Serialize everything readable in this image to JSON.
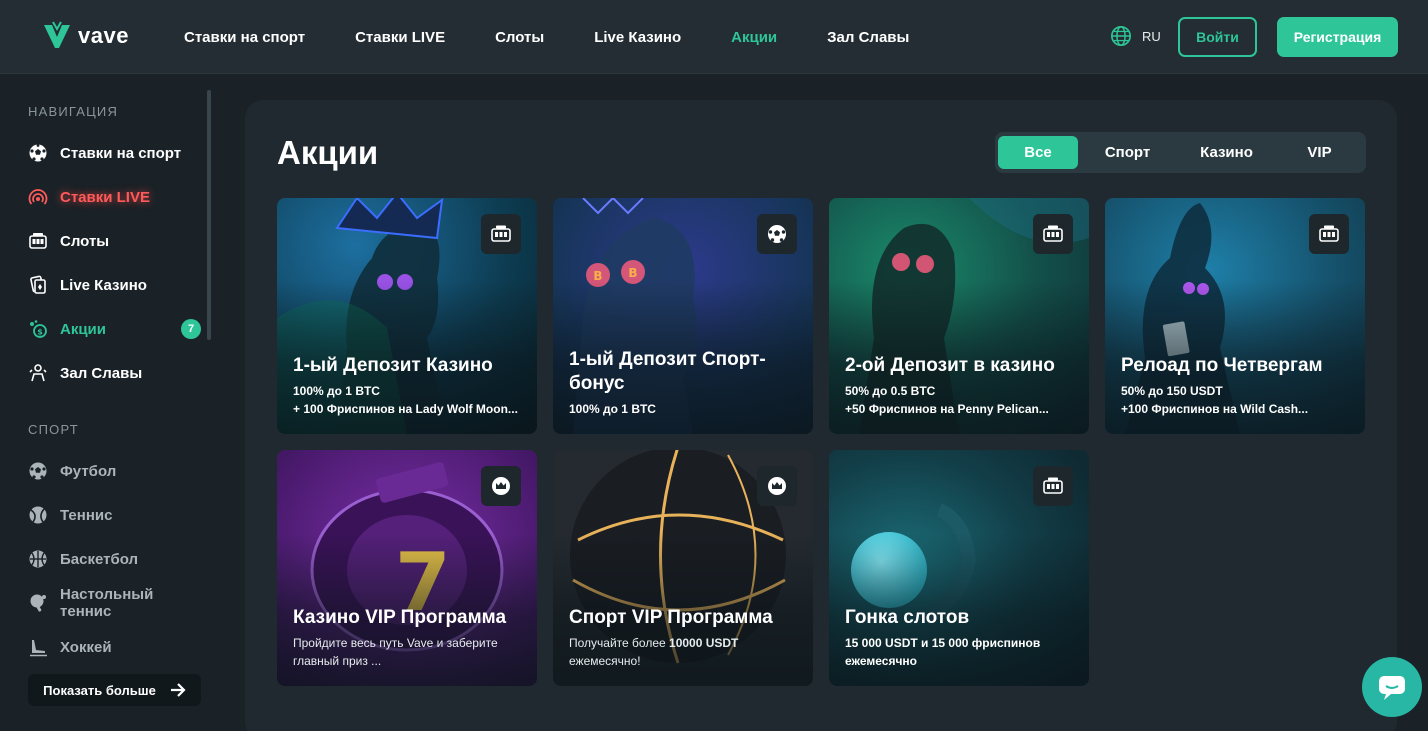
{
  "brand": {
    "name": "vave",
    "accent": "#2ec598"
  },
  "header": {
    "nav": [
      {
        "label": "Ставки на спорт",
        "active": false
      },
      {
        "label": "Ставки LIVE",
        "active": false
      },
      {
        "label": "Слоты",
        "active": false
      },
      {
        "label": "Live Казино",
        "active": false
      },
      {
        "label": "Акции",
        "active": true
      },
      {
        "label": "Зал Славы",
        "active": false
      }
    ],
    "language": "RU",
    "login_label": "Войти",
    "register_label": "Регистрация"
  },
  "sidebar": {
    "nav_heading": "НАВИГАЦИЯ",
    "nav_items": [
      {
        "label": "Ставки на спорт",
        "icon": "soccer-ball-icon"
      },
      {
        "label": "Ставки LIVE",
        "icon": "live-broadcast-icon"
      },
      {
        "label": "Слоты",
        "icon": "slot-machine-icon"
      },
      {
        "label": "Live Казино",
        "icon": "cards-icon"
      },
      {
        "label": "Акции",
        "icon": "promo-icon",
        "badge": "7"
      },
      {
        "label": "Зал Славы",
        "icon": "trophy-person-icon"
      }
    ],
    "sport_heading": "СПОРТ",
    "sport_items": [
      {
        "label": "Футбол",
        "icon": "soccer-ball-icon"
      },
      {
        "label": "Теннис",
        "icon": "tennis-ball-icon"
      },
      {
        "label": "Баскетбол",
        "icon": "basketball-icon"
      },
      {
        "label": "Настольный теннис",
        "icon": "ping-pong-icon"
      },
      {
        "label": "Хоккей",
        "icon": "hockey-skate-icon"
      }
    ],
    "show_more_label": "Показать больше"
  },
  "main": {
    "title": "Акции",
    "filters": [
      {
        "label": "Все",
        "active": true
      },
      {
        "label": "Спорт",
        "active": false
      },
      {
        "label": "Казино",
        "active": false
      },
      {
        "label": "VIP",
        "active": false
      }
    ],
    "promos": [
      {
        "title": "1-ый Депозит Казино",
        "line1": "100% до 1 BTC",
        "line2": "+ 100 Фриспинов на Lady Wolf Moon...",
        "tag_icon": "slot-machine-icon"
      },
      {
        "title": "1-ый Депозит Спорт-бонус",
        "line1": "100% до 1 BTC",
        "line2": "",
        "tag_icon": "soccer-ball-icon"
      },
      {
        "title": "2-ой Депозит в казино",
        "line1": "50% до 0.5 BTC",
        "line2": "+50 Фриспинов на Penny Pelican...",
        "tag_icon": "slot-machine-icon"
      },
      {
        "title": "Релоад по Четвергам",
        "line1": "50% до 150 USDT",
        "line2": "+100 Фриспинов на Wild Cash...",
        "tag_icon": "slot-machine-icon"
      },
      {
        "title": "Казино VIP Программа",
        "line1": "Пройдите весь путь Vave и заберите",
        "line2": "главный приз ...",
        "tag_icon": "crown-icon"
      },
      {
        "title": "Спорт VIP Программа",
        "line1_pre": "Получайте более ",
        "line1_bold": "10000 USDT",
        "line2": "ежемесячно!",
        "tag_icon": "crown-icon"
      },
      {
        "title": "Гонка слотов",
        "line1": "15 000 USDT и 15 000 фриспинов",
        "line2": "ежемесячно",
        "tag_icon": "slot-machine-icon"
      }
    ]
  }
}
